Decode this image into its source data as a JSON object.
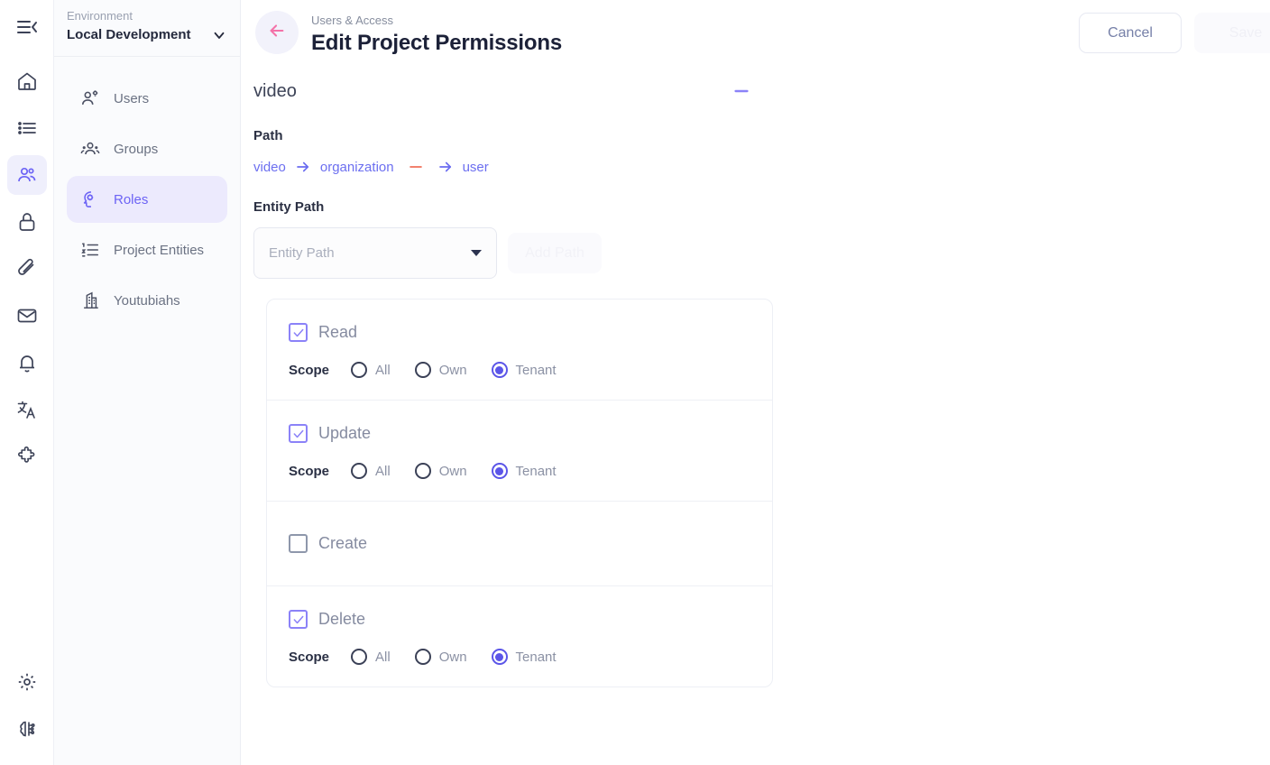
{
  "rail": {
    "collapse": "collapse-sidebar",
    "items": [
      {
        "icon": "home-icon",
        "active": false
      },
      {
        "icon": "list-icon",
        "active": false
      },
      {
        "icon": "users-icon",
        "active": true
      },
      {
        "icon": "lock-icon",
        "active": false
      },
      {
        "icon": "paperclip-icon",
        "active": false
      },
      {
        "icon": "mail-icon",
        "active": false
      },
      {
        "icon": "bell-icon",
        "active": false
      },
      {
        "icon": "translate-icon",
        "active": false
      },
      {
        "icon": "puzzle-icon",
        "active": false
      }
    ],
    "bottom": [
      {
        "icon": "gear-icon"
      },
      {
        "icon": "brain-circuit-icon"
      }
    ]
  },
  "sidebar": {
    "env_label": "Environment",
    "env_value": "Local Development",
    "items": [
      {
        "label": "Users",
        "icon": "user-settings-icon",
        "active": false
      },
      {
        "label": "Groups",
        "icon": "groups-icon",
        "active": false
      },
      {
        "label": "Roles",
        "icon": "roles-head-gear-icon",
        "active": true
      },
      {
        "label": "Project Entities",
        "icon": "ordered-list-icon",
        "active": false
      },
      {
        "label": "Youtubiahs",
        "icon": "building-icon",
        "active": false
      }
    ]
  },
  "header": {
    "breadcrumb": "Users & Access",
    "title": "Edit Project Permissions",
    "back_icon": "arrow-left-icon",
    "cancel_label": "Cancel",
    "save_label": "Save"
  },
  "section": {
    "name": "video",
    "collapse_icon": "minus-icon"
  },
  "path": {
    "label": "Path",
    "nodes": [
      "video",
      "organization",
      "user"
    ],
    "remove_icon": "minus-icon",
    "arrow_icon": "arrow-right-icon"
  },
  "entity_path": {
    "label": "Entity Path",
    "placeholder": "Entity Path",
    "value": "",
    "add_button": "Add Path",
    "caret_icon": "caret-down-icon"
  },
  "scope": {
    "label": "Scope",
    "options": [
      "All",
      "Own",
      "Tenant"
    ]
  },
  "permissions": [
    {
      "name": "Read",
      "checked": true,
      "has_scope": true,
      "scope": "Tenant"
    },
    {
      "name": "Update",
      "checked": true,
      "has_scope": true,
      "scope": "Tenant"
    },
    {
      "name": "Create",
      "checked": false,
      "has_scope": false,
      "scope": ""
    },
    {
      "name": "Delete",
      "checked": true,
      "has_scope": true,
      "scope": "Tenant"
    }
  ],
  "colors": {
    "accent": "#6c63f5",
    "accent_light": "#eceafd",
    "remove": "#f2826e",
    "back_arrow": "#f472a8",
    "text_dark": "#1c2138",
    "text_muted": "#868d9e"
  }
}
